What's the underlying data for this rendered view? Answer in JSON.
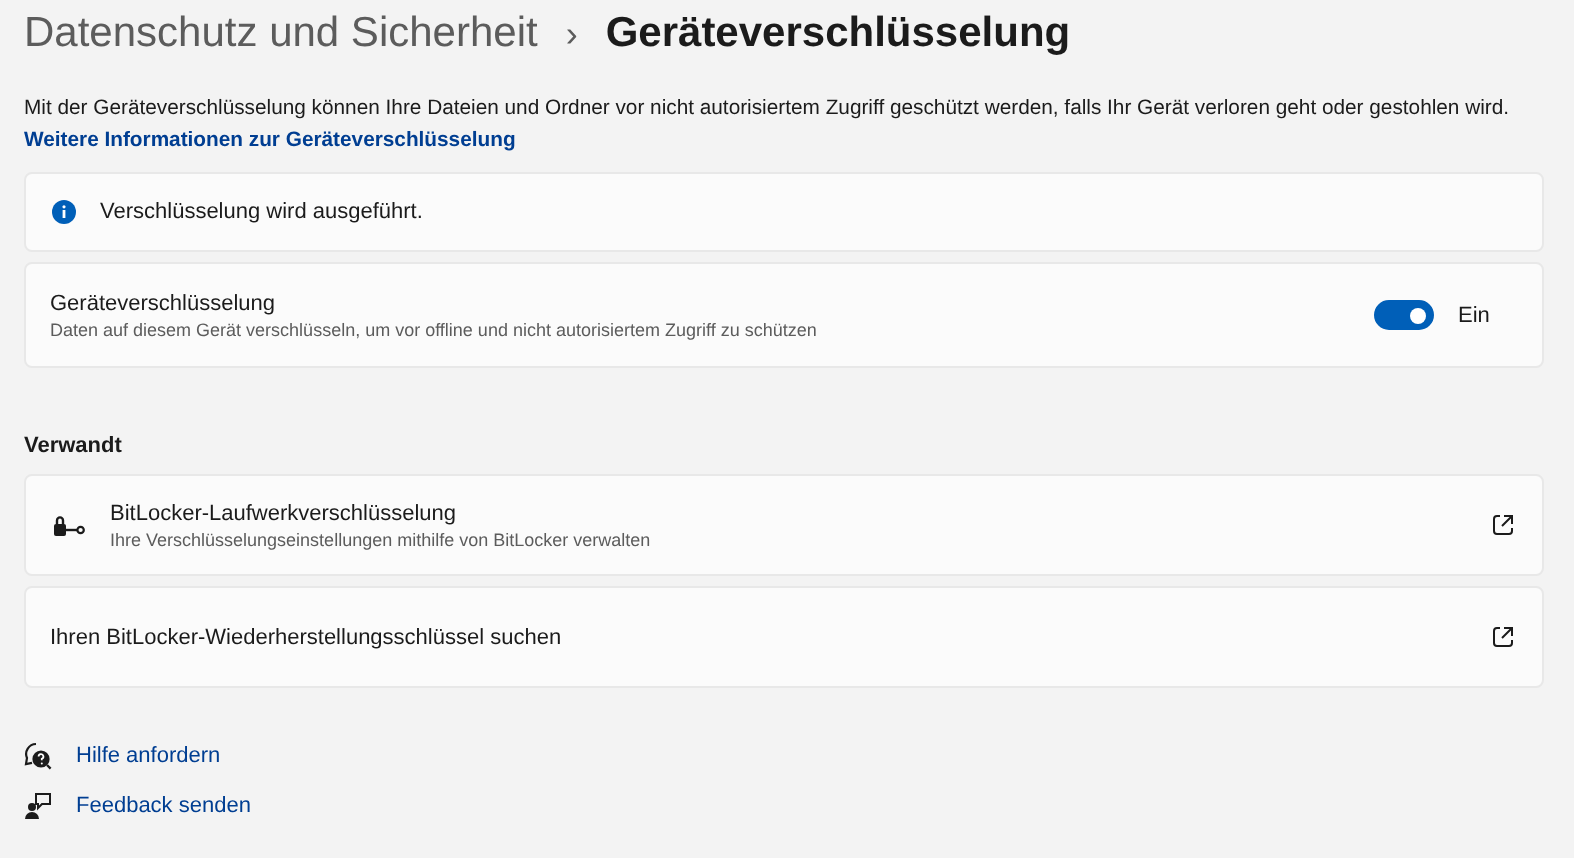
{
  "breadcrumb": {
    "parent": "Datenschutz und Sicherheit",
    "separator": "›",
    "current": "Geräteverschlüsselung"
  },
  "description": "Mit der Geräteverschlüsselung können Ihre Dateien und Ordner vor nicht autorisiertem Zugriff geschützt werden, falls Ihr Gerät verloren geht oder gestohlen wird.",
  "info_link": "Weitere Informationen zur Geräteverschlüsselung",
  "status": {
    "text": "Verschlüsselung wird ausgeführt."
  },
  "setting": {
    "title": "Geräteverschlüsselung",
    "subtitle": "Daten auf diesem Gerät verschlüsseln, um vor offline und nicht autorisiertem Zugriff zu schützen",
    "on": true,
    "state_label": "Ein"
  },
  "related": {
    "heading": "Verwandt",
    "items": [
      {
        "kind": "bitlocker",
        "title": "BitLocker-Laufwerkverschlüsselung",
        "subtitle": "Ihre Verschlüsselungseinstellungen mithilfe von BitLocker verwalten"
      },
      {
        "kind": "plain",
        "title": "Ihren BitLocker-Wiederherstellungsschlüssel suchen"
      }
    ]
  },
  "help_links": [
    {
      "kind": "help",
      "label": "Hilfe anfordern"
    },
    {
      "kind": "feedback",
      "label": "Feedback senden"
    }
  ]
}
